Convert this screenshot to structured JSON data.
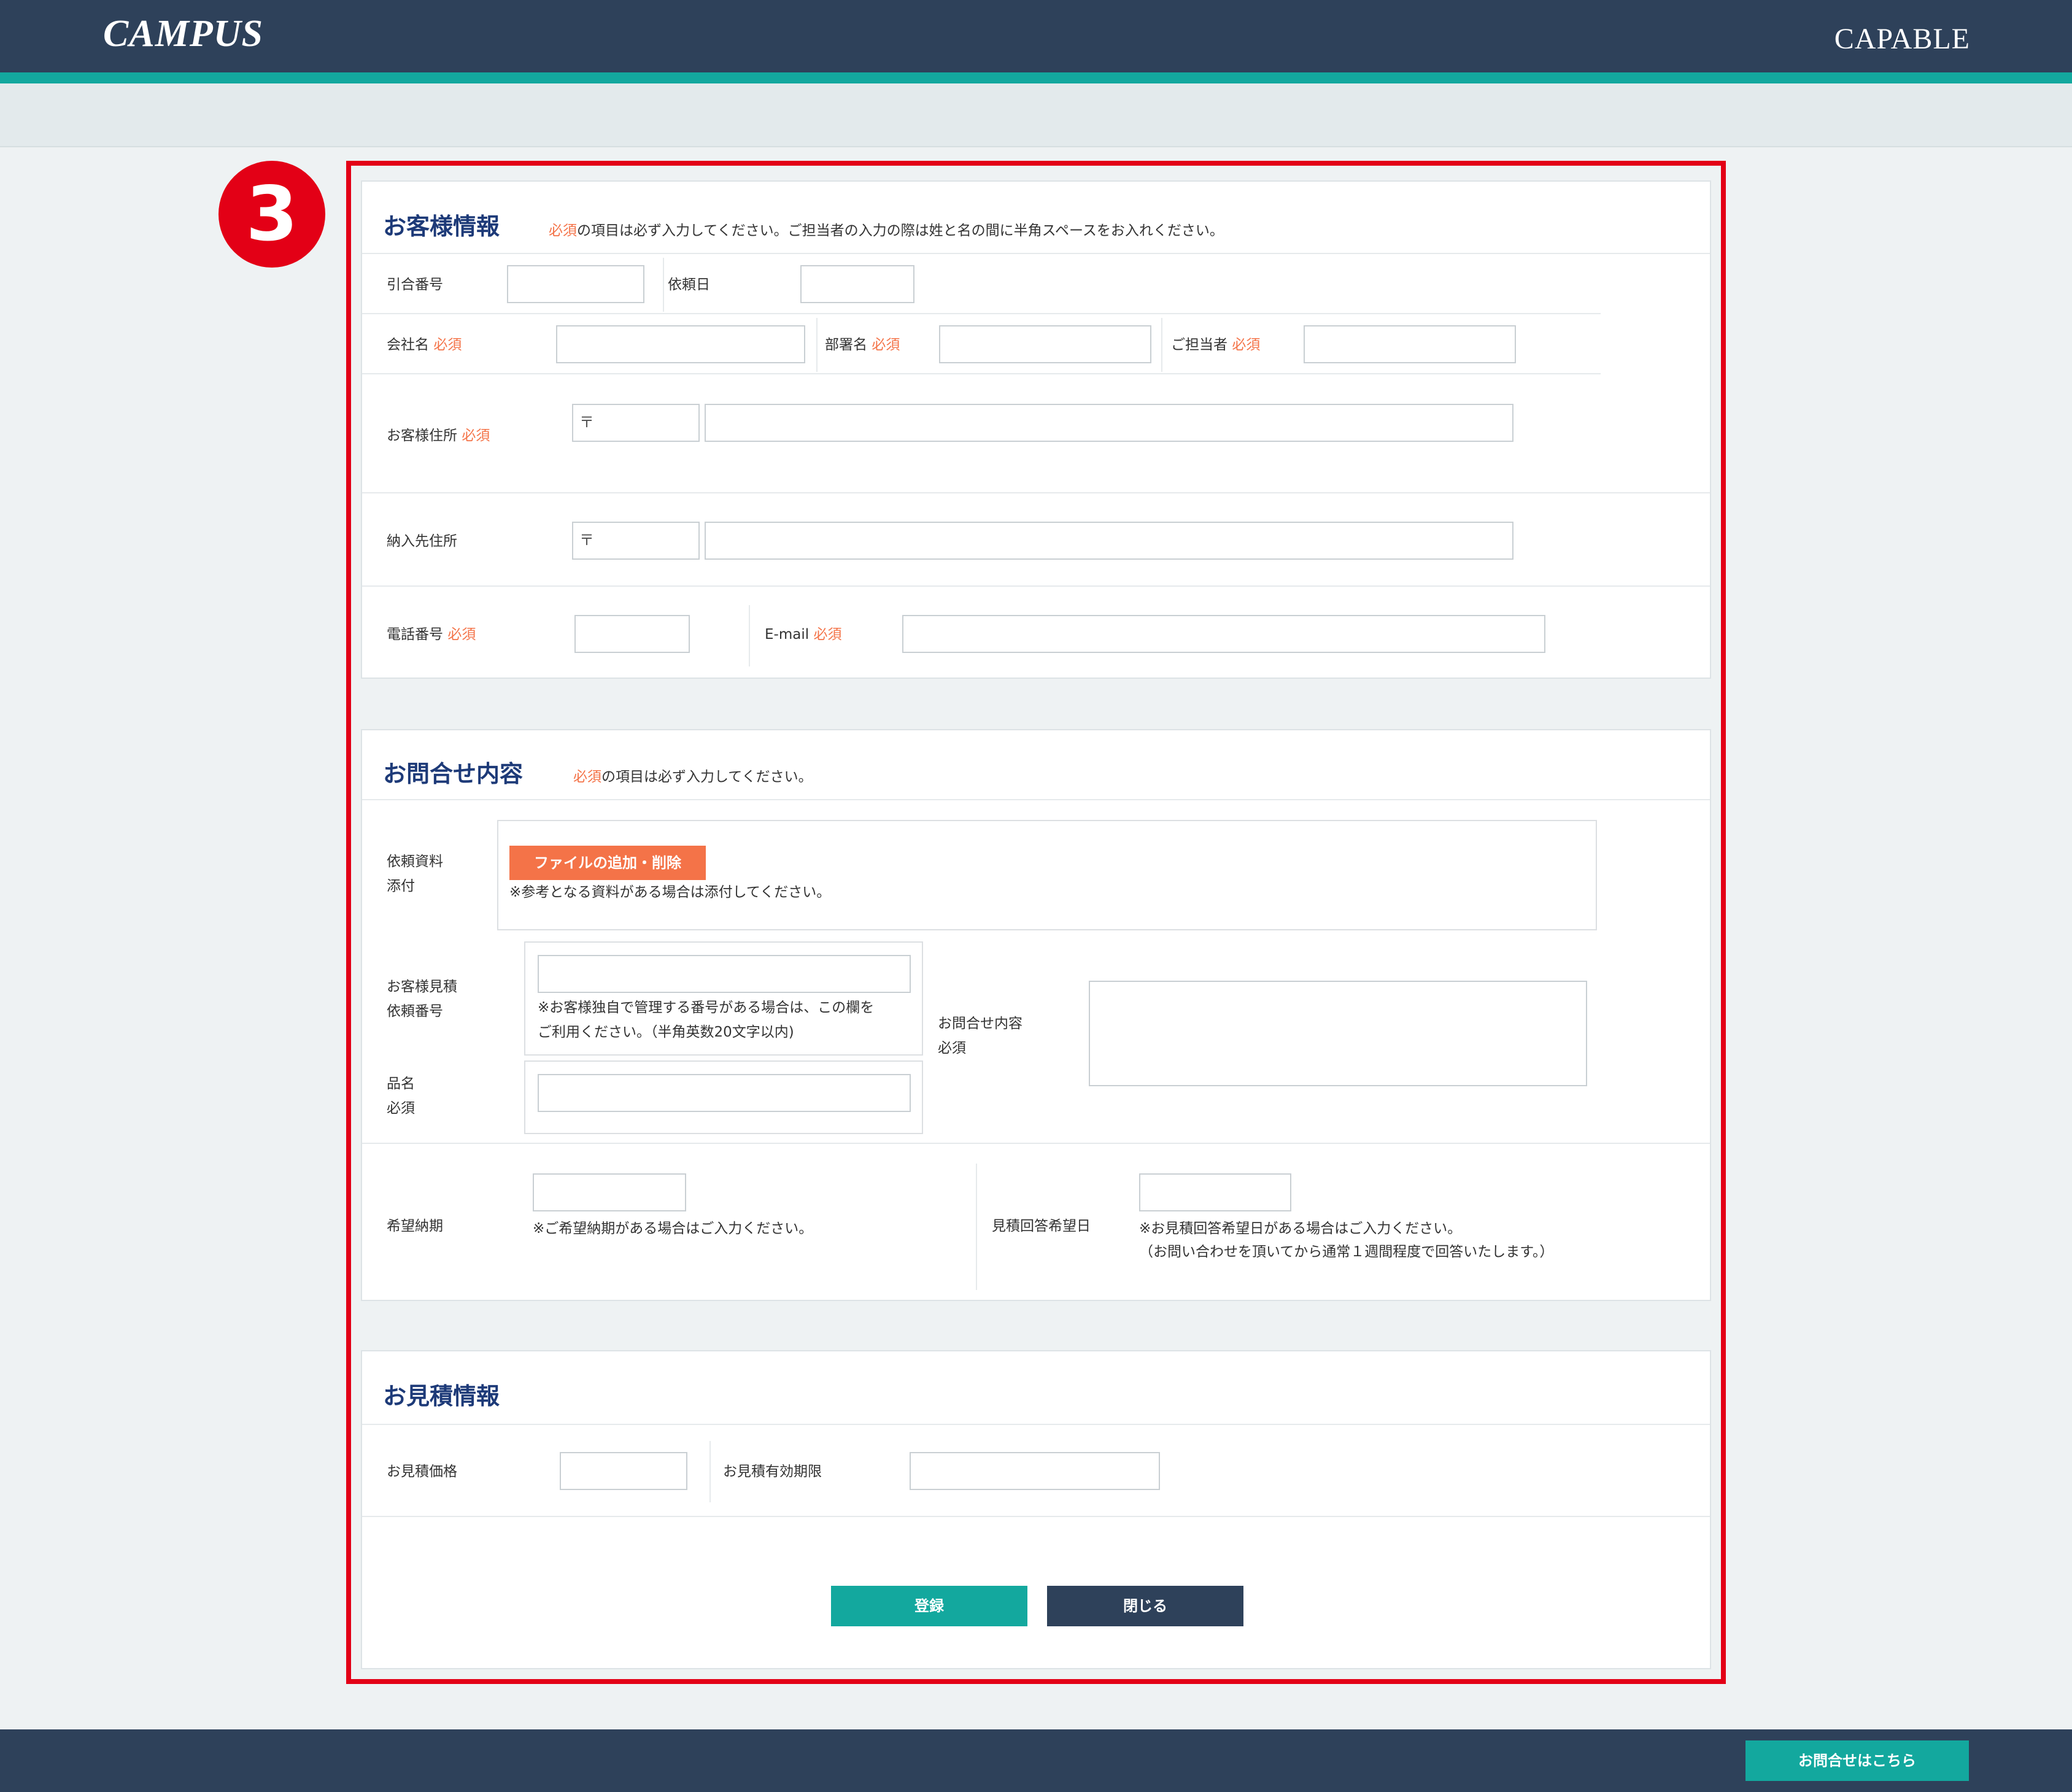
{
  "header": {
    "logo_left": "CAMPUS",
    "logo_right": "CAPABLE"
  },
  "badge": "3",
  "required": "必須",
  "postal_mark": "〒",
  "customer": {
    "title": "お客様情報",
    "note_rest": "の項目は必ず入力してください。ご担当者の入力の際は姓と名の間に半角スペースをお入れください。",
    "ref_no": "引合番号",
    "req_date": "依頼日",
    "company": "会社名",
    "dept": "部署名",
    "person": "ご担当者",
    "address": "お客様住所",
    "delivery": "納入先住所",
    "phone": "電話番号",
    "email": "E-mail"
  },
  "inquiry": {
    "title": "お問合せ内容",
    "note_rest": "の項目は必ず入力してください。",
    "attach_l1": "依頼資料",
    "attach_l2": "添付",
    "file_button": "ファイルの追加・削除",
    "file_note": "※参考となる資料がある場合は添付してください。",
    "est_l1": "お客様見積",
    "est_l2": "依頼番号",
    "est_note1": "※お客様独自で管理する番号がある場合は、この欄を",
    "est_note2": "ご利用ください。（半角英数20文字以内)",
    "product": "品名",
    "content": "お問合せ内容",
    "due": "希望納期",
    "due_note": "※ご希望納期がある場合はご入力ください。",
    "reply": "見積回答希望日",
    "reply_note1": "※お見積回答希望日がある場合はご入力ください。",
    "reply_note2": "（お問い合わせを頂いてから通常１週間程度で回答いたします。）"
  },
  "quote": {
    "title": "お見積情報",
    "price": "お見積価格",
    "expiry": "お見積有効期限"
  },
  "actions": {
    "submit": "登録",
    "close": "閉じる"
  },
  "footer": {
    "contact": "お問合せはこちら"
  }
}
